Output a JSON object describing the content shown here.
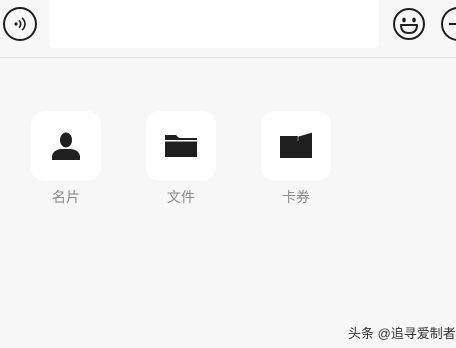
{
  "input_bar": {
    "voice_icon": "voice-wave-icon",
    "message_value": "",
    "emoji_icon": "smiley-face-icon",
    "more_icon": "plus-circle-icon"
  },
  "panel": {
    "items": [
      {
        "label": "名片",
        "icon": "person-icon"
      },
      {
        "label": "文件",
        "icon": "folder-icon"
      },
      {
        "label": "卡券",
        "icon": "wallet-icon"
      }
    ]
  },
  "watermark": {
    "text": "头条 @追寻爱制者"
  }
}
